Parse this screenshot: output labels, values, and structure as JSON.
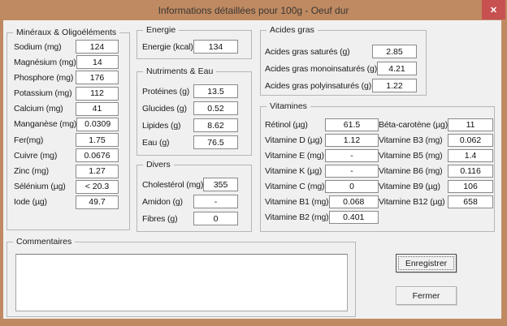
{
  "window": {
    "title": "Informations détaillées pour 100g - Oeuf dur",
    "close_glyph": "✕"
  },
  "colors": {
    "titlebar": "#bf8a62",
    "close_button": "#c75050",
    "dialog_bg": "#f0f0f0",
    "field_border": "#8a8a8a"
  },
  "groups": {
    "minerals": {
      "title": "Minéraux & Oligoéléments",
      "fields": [
        {
          "label": "Sodium (mg)",
          "value": "124"
        },
        {
          "label": "Magnésium (mg)",
          "value": "14"
        },
        {
          "label": "Phosphore (mg)",
          "value": "176"
        },
        {
          "label": "Potassium (mg)",
          "value": "112"
        },
        {
          "label": "Calcium (mg)",
          "value": "41"
        },
        {
          "label": "Manganèse (mg)",
          "value": "0.0309"
        },
        {
          "label": "Fer(mg)",
          "value": "1.75"
        },
        {
          "label": "Cuivre (mg)",
          "value": "0.0676"
        },
        {
          "label": "Zinc (mg)",
          "value": "1.27"
        },
        {
          "label": "Sélénium (µg)",
          "value": "< 20.3"
        },
        {
          "label": "Iode (µg)",
          "value": "49.7"
        }
      ]
    },
    "energy": {
      "title": "Energie",
      "fields": [
        {
          "label": "Energie (kcal)",
          "value": "134"
        }
      ]
    },
    "nutrients": {
      "title": "Nutriments & Eau",
      "fields": [
        {
          "label": "Protéines (g)",
          "value": "13.5"
        },
        {
          "label": "Glucides (g)",
          "value": "0.52"
        },
        {
          "label": "Lipides (g)",
          "value": "8.62"
        },
        {
          "label": "Eau (g)",
          "value": "76.5"
        }
      ]
    },
    "misc": {
      "title": "Divers",
      "fields": [
        {
          "label": "Cholestérol (mg)",
          "value": "355"
        },
        {
          "label": "Amidon (g)",
          "value": "-"
        },
        {
          "label": "Fibres (g)",
          "value": "0"
        }
      ]
    },
    "fats": {
      "title": "Acides gras",
      "fields": [
        {
          "label": "Acides gras saturés (g)",
          "value": "2.85"
        },
        {
          "label": "Acides gras monoinsaturés (g)",
          "value": "4.21"
        },
        {
          "label": "Acides gras polyinsaturés (g)",
          "value": "1.22"
        }
      ]
    },
    "vitamins": {
      "title": "Vitamines",
      "col1": [
        {
          "label": "Rétinol (µg)",
          "value": "61.5"
        },
        {
          "label": "Vitamine D (µg)",
          "value": "1.12"
        },
        {
          "label": "Vitamine E (mg)",
          "value": "-"
        },
        {
          "label": "Vitamine K (µg)",
          "value": "-"
        },
        {
          "label": "Vitamine C (mg)",
          "value": "0"
        },
        {
          "label": "Vitamine B1 (mg)",
          "value": "0.068"
        },
        {
          "label": "Vitamine B2 (mg)",
          "value": "0.401"
        }
      ],
      "col2": [
        {
          "label": "Béta-carotène (µg)",
          "value": "11"
        },
        {
          "label": "Vitamine B3 (mg)",
          "value": "0.062"
        },
        {
          "label": "Vitamine B5 (mg)",
          "value": "1.4"
        },
        {
          "label": "Vitamine B6 (mg)",
          "value": "0.116"
        },
        {
          "label": "Vitamine B9 (µg)",
          "value": "106"
        },
        {
          "label": "Vitamine B12 (µg)",
          "value": "658"
        }
      ]
    },
    "comments": {
      "title": "Commentaires",
      "value": ""
    }
  },
  "buttons": {
    "save": "Enregistrer",
    "close": "Fermer"
  }
}
